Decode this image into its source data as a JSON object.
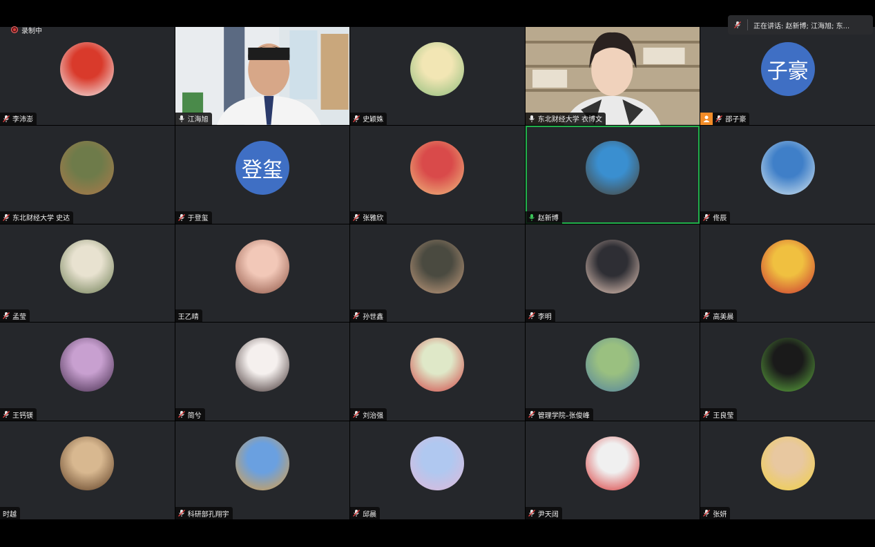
{
  "recording": {
    "label": "录制中"
  },
  "speaking": {
    "text": "正在讲话: 赵新博; 江海旭; 东..."
  },
  "participants": [
    {
      "name": "李沛澎",
      "muted": true,
      "type": "photo",
      "c1": "#d93a2b",
      "c2": "#f5f5f5"
    },
    {
      "name": "江海旭",
      "muted": false,
      "type": "video"
    },
    {
      "name": "史颖姝",
      "muted": true,
      "type": "photo",
      "c1": "#f2e6b4",
      "c2": "#8bbb7a"
    },
    {
      "name": "东北财经大学 衣博文",
      "muted": false,
      "type": "video2"
    },
    {
      "name": "邵子豪",
      "muted": true,
      "type": "text",
      "initials": "子豪",
      "host": true
    },
    {
      "name": "东北财经大学 史达",
      "muted": true,
      "type": "photo",
      "c1": "#6e7b4a",
      "c2": "#b07a4a"
    },
    {
      "name": "于登玺",
      "muted": true,
      "type": "text",
      "initials": "登玺"
    },
    {
      "name": "张雅欣",
      "muted": true,
      "type": "photo",
      "c1": "#d94a4a",
      "c2": "#f0c080"
    },
    {
      "name": "赵新博",
      "muted": false,
      "speaking": true,
      "type": "photo",
      "c1": "#3a8fd0",
      "c2": "#4a4030"
    },
    {
      "name": "佟辰",
      "muted": true,
      "type": "photo",
      "c1": "#3f7fc8",
      "c2": "#d8e8f0"
    },
    {
      "name": "孟莹",
      "muted": true,
      "type": "photo",
      "c1": "#e8e2d0",
      "c2": "#6a7a50"
    },
    {
      "name": "王乙晴",
      "muted": null,
      "type": "photo",
      "c1": "#f2c8b8",
      "c2": "#8a5040"
    },
    {
      "name": "孙世鑫",
      "muted": true,
      "type": "photo",
      "c1": "#4a4a40",
      "c2": "#c8a080"
    },
    {
      "name": "李明",
      "muted": true,
      "type": "photo",
      "c1": "#2e2e34",
      "c2": "#f0d0c0"
    },
    {
      "name": "高美晨",
      "muted": true,
      "type": "photo",
      "c1": "#f0c040",
      "c2": "#c83030"
    },
    {
      "name": "王钙镁",
      "muted": true,
      "type": "photo",
      "c1": "#c8a0d0",
      "c2": "#402848"
    },
    {
      "name": "简兮",
      "muted": true,
      "type": "photo",
      "c1": "#f5f0ee",
      "c2": "#3a2a2a"
    },
    {
      "name": "刘治强",
      "muted": true,
      "type": "photo",
      "c1": "#dfe8c8",
      "c2": "#d04040"
    },
    {
      "name": "管理学院–张俊峰",
      "muted": true,
      "type": "photo",
      "c1": "#9ac080",
      "c2": "#5080a0"
    },
    {
      "name": "王良莹",
      "muted": true,
      "type": "photo",
      "c1": "#1a1a1a",
      "c2": "#60b040"
    },
    {
      "name": "时越",
      "muted": null,
      "type": "photo",
      "c1": "#d8b890",
      "c2": "#5a3a20"
    },
    {
      "name": "科研部孔翔宇",
      "muted": true,
      "type": "photo",
      "c1": "#6aa0e0",
      "c2": "#e0a040"
    },
    {
      "name": "邱晨",
      "muted": true,
      "type": "photo",
      "c1": "#b0c8f0",
      "c2": "#e0b8d8"
    },
    {
      "name": "尹天阔",
      "muted": true,
      "type": "photo",
      "c1": "#f0f0f0",
      "c2": "#d83030"
    },
    {
      "name": "张妍",
      "muted": true,
      "type": "photo",
      "c1": "#e8c8a0",
      "c2": "#f0d040"
    }
  ]
}
